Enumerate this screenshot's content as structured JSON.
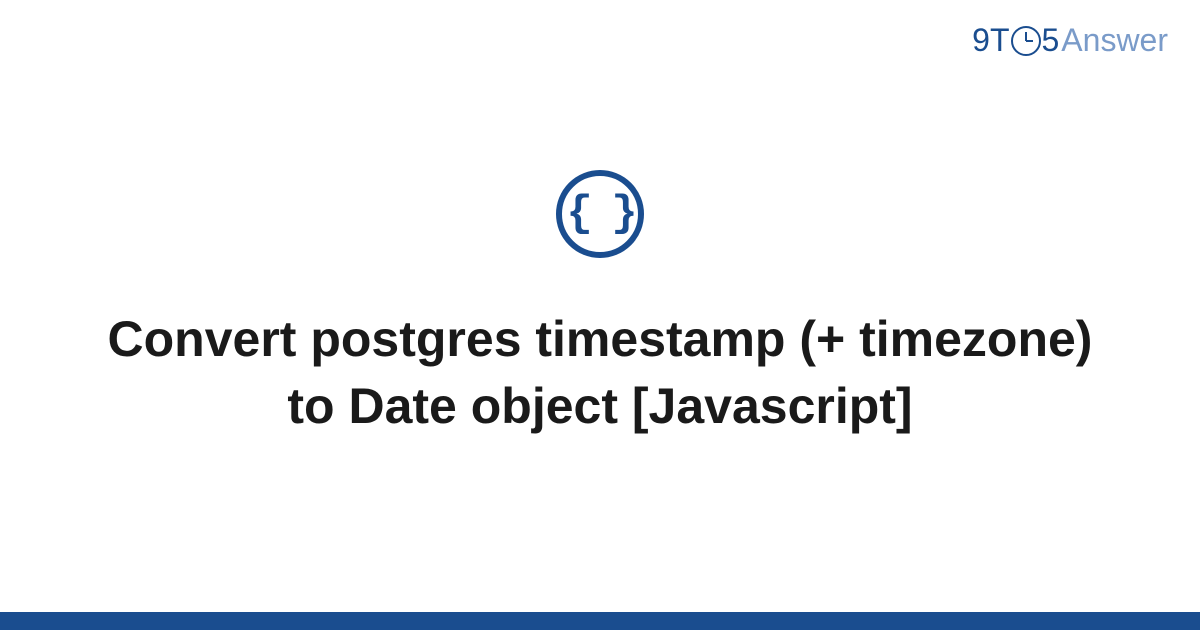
{
  "brand": {
    "part1": "9T",
    "part2": "5",
    "part3": "Answer"
  },
  "category": {
    "icon_name": "code-braces",
    "glyph": "{ }"
  },
  "title": "Convert postgres timestamp (+ timezone) to Date object [Javascript]",
  "colors": {
    "primary": "#1a4d8f",
    "brand_light": "#7a9bc9",
    "text": "#1a1a1a"
  }
}
